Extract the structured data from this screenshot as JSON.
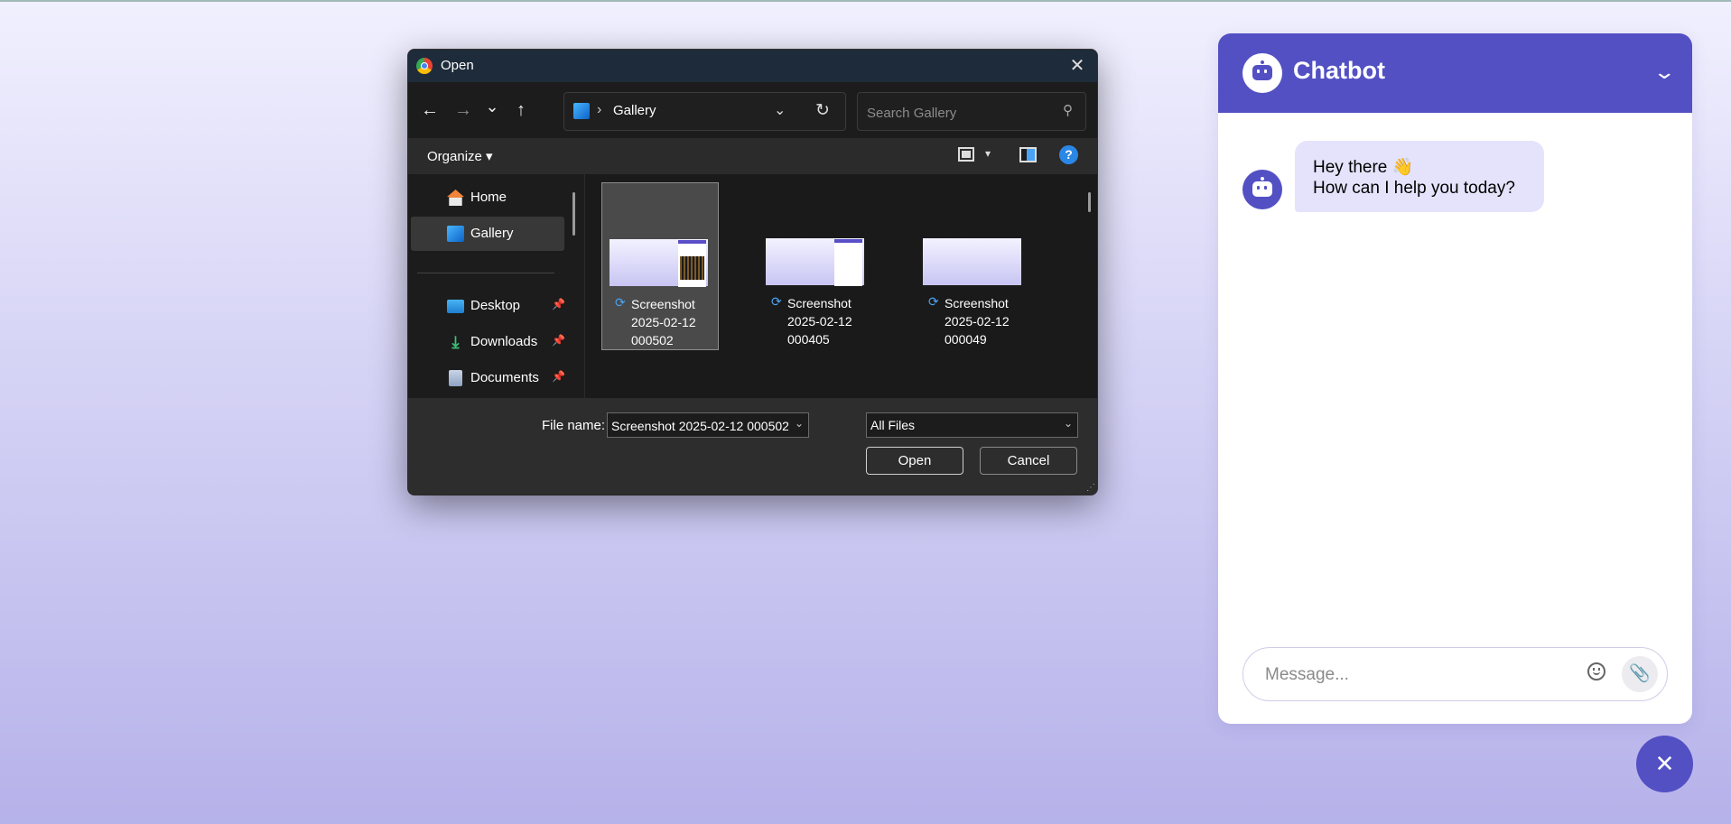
{
  "dialog": {
    "title": "Open",
    "close_glyph": "✕",
    "nav": {
      "back": "←",
      "forward": "→",
      "recent": "⌄",
      "up": "↑"
    },
    "address": {
      "separator": "›",
      "path": "Gallery",
      "dropdown": "⌄",
      "refresh": "↻"
    },
    "search": {
      "placeholder": "Search Gallery",
      "icon_glyph": "⚲"
    },
    "toolbar": {
      "organize_label": "Organize ▾",
      "view_caret": "▾",
      "help_glyph": "?"
    },
    "sidebar": {
      "items": [
        {
          "label": "Home",
          "icon": "home-icon",
          "selected": false
        },
        {
          "label": "Gallery",
          "icon": "gallery-icon",
          "selected": true
        },
        {
          "label": "Desktop",
          "icon": "desktop-icon",
          "pinned": true
        },
        {
          "label": "Downloads",
          "icon": "downloads-icon",
          "pinned": true
        },
        {
          "label": "Documents",
          "icon": "documents-icon",
          "pinned": true
        }
      ],
      "pin_glyph": "📌",
      "download_glyph": "⤓"
    },
    "files": [
      {
        "line1": "Screenshot",
        "line2": "2025-02-12",
        "line3": "000502",
        "selected": true
      },
      {
        "line1": "Screenshot",
        "line2": "2025-02-12",
        "line3": "000405",
        "selected": false
      },
      {
        "line1": "Screenshot",
        "line2": "2025-02-12",
        "line3": "000049",
        "selected": false
      }
    ],
    "sync_glyph": "⟳",
    "footer": {
      "file_name_label": "File name:",
      "file_name_value": "Screenshot 2025-02-12 000502",
      "file_type": "All Files",
      "dropdown_glyph": "⌄",
      "open_label": "Open",
      "cancel_label": "Cancel"
    }
  },
  "chatbot": {
    "title": "Chatbot",
    "collapse_glyph": "⌄",
    "messages": [
      {
        "from": "bot",
        "line1": "Hey there 👋",
        "line2": "How can I help you today?"
      }
    ],
    "composer": {
      "placeholder": "Message...",
      "attach_glyph": "📎"
    },
    "fab_glyph": "✕"
  },
  "colors": {
    "accent": "#5350c4",
    "bubble": "#e4e3fb",
    "dialog_bg": "#1c1c1c"
  }
}
